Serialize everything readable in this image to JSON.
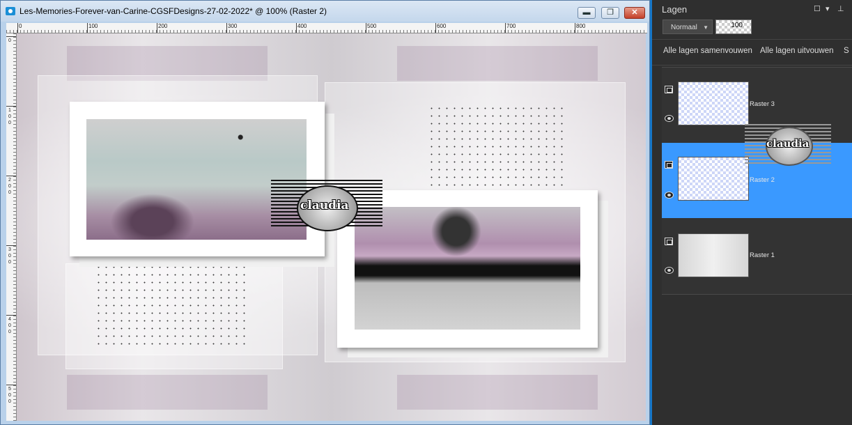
{
  "document": {
    "title": "Les-Memories-Forever-van-Carine-CGSFDesigns-27-02-2022* @ 100% (Raster 2)",
    "controls": {
      "minimize": "▬",
      "restore": "❐",
      "close": "✕"
    },
    "ruler_h_labels": [
      "0",
      "100",
      "200",
      "300",
      "400",
      "500",
      "600",
      "700",
      "800"
    ],
    "ruler_v_labels": [
      "0",
      "1 0 0",
      "2 0 0",
      "3 0 0",
      "4 0 0",
      "5 0 0"
    ],
    "watermark_text": "claudia"
  },
  "layers_palette": {
    "title": "Lagen",
    "window_controls": {
      "float": "☐",
      "menu": "▾",
      "pin": "⊥"
    },
    "blend_mode": "Normaal",
    "opacity": "100",
    "collapse_all": "Alle lagen samenvouwen",
    "expand_all": "Alle lagen uitvouwen",
    "more_link": "S",
    "layers": [
      {
        "name": "Raster 3",
        "selected": false
      },
      {
        "name": "Raster 2",
        "selected": true
      },
      {
        "name": "Raster 1",
        "selected": false
      }
    ],
    "watermark_text": "claudia"
  },
  "colors": {
    "selection": "#3a99ff",
    "palette_bg": "#2f2f2f",
    "window_frame": "#b9d1ea",
    "close_button": "#c4402a"
  }
}
